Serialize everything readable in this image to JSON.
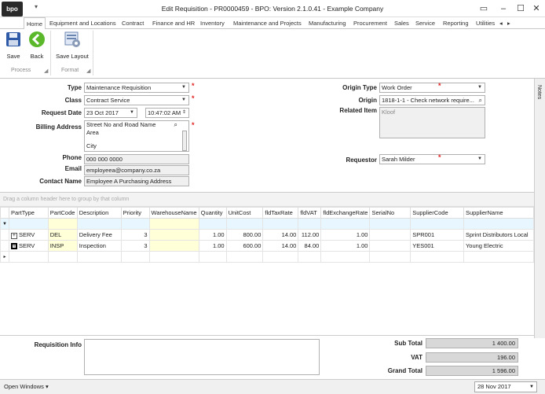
{
  "app": {
    "logo": "bpo",
    "window_title": "Edit Requisition - PR0000459 - BPO: Version 2.1.0.41 - Example Company"
  },
  "menu_tabs": [
    "Home",
    "Equipment and Locations",
    "Contract",
    "Finance and HR",
    "Inventory",
    "Maintenance and Projects",
    "Manufacturing",
    "Procurement",
    "Sales",
    "Service",
    "Reporting",
    "Utilities"
  ],
  "ribbon": {
    "save": "Save",
    "back": "Back",
    "save_layout": "Save Layout",
    "group_process": "Process",
    "group_format": "Format"
  },
  "form": {
    "type_label": "Type",
    "type_value": "Maintenance Requisition",
    "class_label": "Class",
    "class_value": "Contract Service",
    "request_date_label": "Request Date",
    "request_date": "23 Oct 2017",
    "request_time": "10:47:02 AM",
    "billing_label": "Billing Address",
    "billing_line1": "Street No and Road Name",
    "billing_line2": "Area",
    "billing_line3": "City",
    "phone_label": "Phone",
    "phone_value": "000 000 0000",
    "email_label": "Email",
    "email_value": "employeea@company.co.za",
    "contact_label": "Contact Name",
    "contact_value": "Employee A Purchasing Address",
    "origin_type_label": "Origin Type",
    "origin_type_value": "Work Order",
    "origin_label": "Origin",
    "origin_value": "1818-1-1 - Check network require...",
    "related_item_label": "Related Item",
    "related_item_value": "Kloof",
    "requestor_label": "Requestor",
    "requestor_value": "Sarah Milder"
  },
  "notes_tab": "Notes",
  "grid": {
    "group_hint": "Drag a column header here to group by that column",
    "columns": [
      "PartType",
      "PartCode",
      "Description",
      "Priority",
      "WarehouseName",
      "Quantity",
      "UnitCost",
      "fldTaxRate",
      "fldVAT",
      "fldExchangeRate",
      "SerialNo",
      "SupplierCode",
      "SupplierName"
    ],
    "rows": [
      [
        "SERV",
        "DEL",
        "Delivery Fee",
        "3",
        "",
        "1.00",
        "800.00",
        "14.00",
        "112.00",
        "1.00",
        "",
        "SPR001",
        "Sprint Distributors Local"
      ],
      [
        "SERV",
        "INSP",
        "Inspection",
        "3",
        "",
        "1.00",
        "600.00",
        "14.00",
        "84.00",
        "1.00",
        "",
        "YES001",
        "Young Electric"
      ]
    ]
  },
  "footer": {
    "req_info_label": "Requisition Info",
    "subtotal_label": "Sub Total",
    "subtotal_value": "1 400.00",
    "vat_label": "VAT",
    "vat_value": "196.00",
    "grand_total_label": "Grand Total",
    "grand_total_value": "1 596.00"
  },
  "statusbar": {
    "open_windows": "Open Windows",
    "date": "28 Nov 2017"
  },
  "colors": {
    "required": "#e02020",
    "filter_row": "#e8f7ff",
    "editable_cell": "#ffffd8"
  }
}
